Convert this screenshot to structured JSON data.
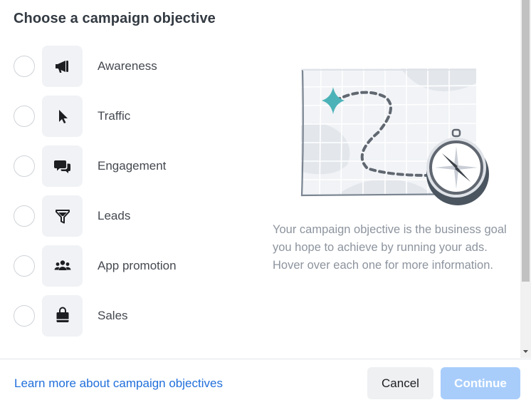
{
  "dialog": {
    "title": "Choose a campaign objective"
  },
  "objectives": [
    {
      "label": "Awareness",
      "icon": "megaphone-icon",
      "selected": false
    },
    {
      "label": "Traffic",
      "icon": "cursor-icon",
      "selected": false
    },
    {
      "label": "Engagement",
      "icon": "chat-bubbles-icon",
      "selected": false
    },
    {
      "label": "Leads",
      "icon": "funnel-icon",
      "selected": false
    },
    {
      "label": "App promotion",
      "icon": "people-icon",
      "selected": false
    },
    {
      "label": "Sales",
      "icon": "shopping-bag-icon",
      "selected": false
    }
  ],
  "help": {
    "text": "Your campaign objective is the business goal you hope to achieve by running your ads. Hover over each one for more information."
  },
  "footer": {
    "learn_more": "Learn more about campaign objectives",
    "cancel_label": "Cancel",
    "continue_label": "Continue",
    "continue_enabled": false
  },
  "colors": {
    "link": "#216fdb",
    "continue_disabled": "#a8cdfb",
    "tile_bg": "#f0f2f5",
    "illustration_star": "#4bb3b8"
  }
}
